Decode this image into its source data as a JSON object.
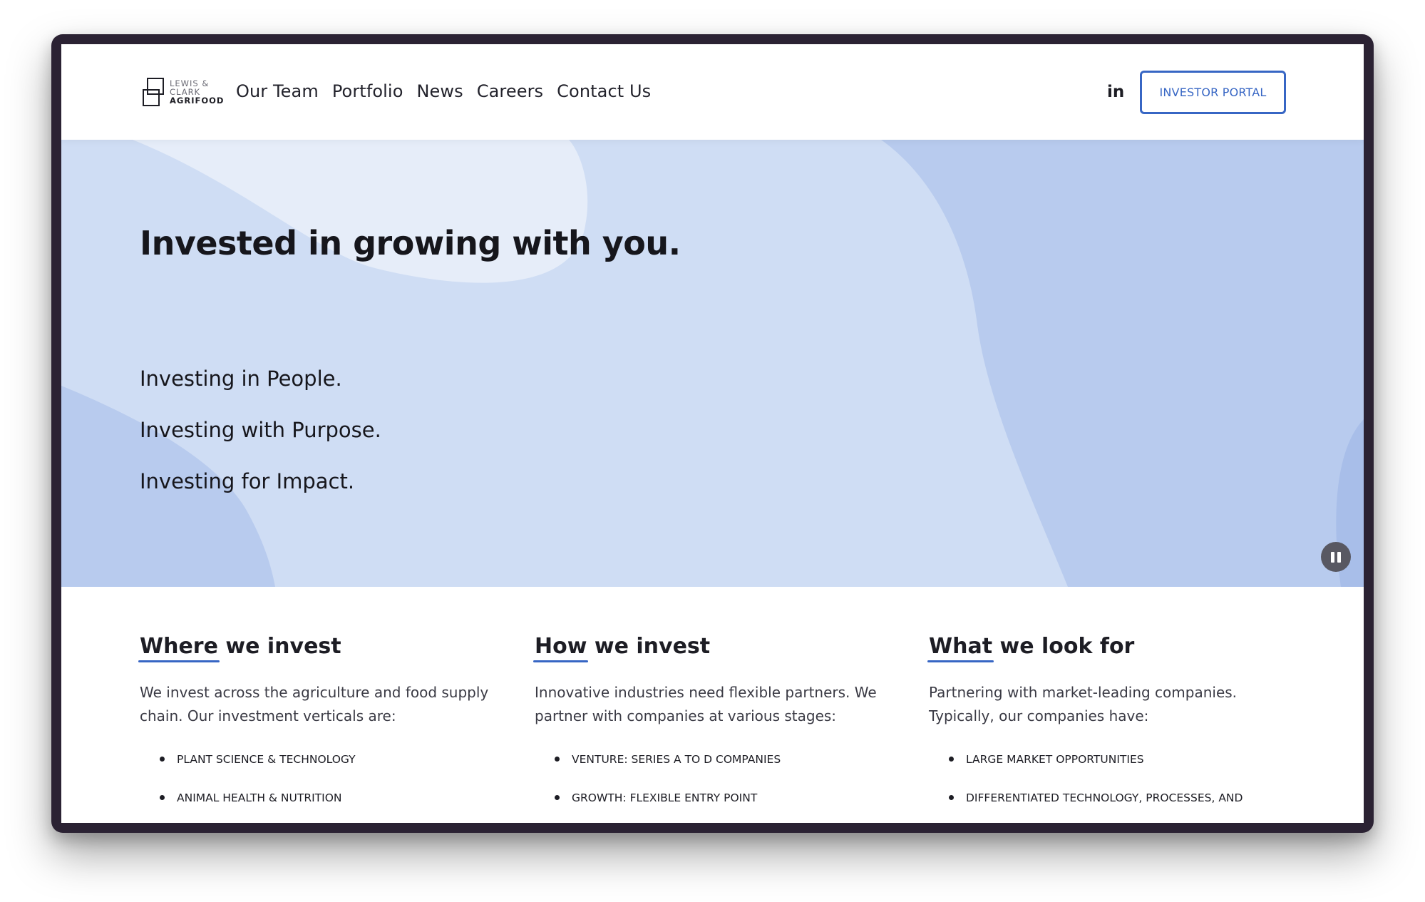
{
  "brand": {
    "logo_line1": "LEWIS &",
    "logo_line2": "CLARK",
    "logo_line3": "AGRIFOOD"
  },
  "nav": {
    "items": [
      {
        "label": "Our Team"
      },
      {
        "label": "Portfolio"
      },
      {
        "label": "News"
      },
      {
        "label": "Careers"
      },
      {
        "label": "Contact Us"
      }
    ],
    "linkedin_label": "in",
    "investor_portal_label": "INVESTOR PORTAL"
  },
  "hero": {
    "title": "Invested in growing with you.",
    "lines": [
      "Investing in People.",
      "Investing with Purpose.",
      "Investing for Impact."
    ],
    "pause_icon": "pause-icon"
  },
  "columns": [
    {
      "title_underlined": "Where",
      "title_rest": " we invest",
      "text": "We invest across the agriculture and food supply chain. Our investment verticals are:",
      "items": [
        "PLANT SCIENCE & TECHNOLOGY",
        "ANIMAL HEALTH & NUTRITION"
      ]
    },
    {
      "title_underlined": "How",
      "title_rest": " we invest",
      "text": "Innovative industries need flexible partners. We partner with companies at various stages:",
      "items": [
        "VENTURE: SERIES A TO D COMPANIES",
        "GROWTH: FLEXIBLE ENTRY POINT"
      ]
    },
    {
      "title_underlined": "What",
      "title_rest": " we look for",
      "text": "Partnering with market-leading companies. Typically, our companies have:",
      "items": [
        "LARGE MARKET OPPORTUNITIES",
        "DIFFERENTIATED TECHNOLOGY, PROCESSES, AND"
      ]
    }
  ],
  "colors": {
    "accent": "#3766c4",
    "hero_bg": "#cfddf4",
    "hero_light": "#e6edf9",
    "hero_dark": "#b8cbee",
    "frame": "#2b2233"
  }
}
